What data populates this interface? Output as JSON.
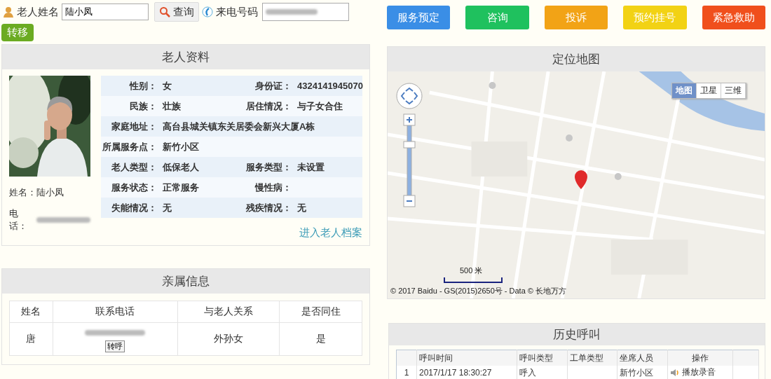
{
  "search": {
    "name_label": "老人姓名",
    "name_value": "陆小凤",
    "query_button": "查询",
    "phone_label": "来电号码"
  },
  "transfer_button": "转移",
  "action_buttons": [
    {
      "label": "服务预定",
      "color": "#3a8ee6"
    },
    {
      "label": "咨询",
      "color": "#1fc15e"
    },
    {
      "label": "投诉",
      "color": "#f2a316"
    },
    {
      "label": "预约挂号",
      "color": "#f2d214"
    },
    {
      "label": "紧急救助",
      "color": "#f04f1c"
    }
  ],
  "profile": {
    "title": "老人资料",
    "name_line": "姓名：陆小凤",
    "phone_label": "电话：",
    "fields": [
      [
        {
          "label": "性别：",
          "value": "女"
        },
        {
          "label": "身份证：",
          "value": "4324141945070"
        }
      ],
      [
        {
          "label": "民族：",
          "value": "壮族"
        },
        {
          "label": "居住情况：",
          "value": "与子女合住"
        }
      ],
      [
        {
          "label": "家庭地址：",
          "value": "高台县城关镇东关居委会新兴大厦A栋"
        }
      ],
      [
        {
          "label": "所属服务点：",
          "value": "新竹小区"
        }
      ],
      [
        {
          "label": "老人类型：",
          "value": "低保老人"
        },
        {
          "label": "服务类型：",
          "value": "未设置"
        }
      ],
      [
        {
          "label": "服务状态：",
          "value": "正常服务"
        },
        {
          "label": "慢性病："
        }
      ],
      [
        {
          "label": "失能情况：",
          "value": "无"
        },
        {
          "label": "残疾情况：",
          "value": "无"
        }
      ]
    ],
    "archive_link": "进入老人档案"
  },
  "relatives": {
    "title": "亲属信息",
    "columns": [
      "姓名",
      "联系电话",
      "与老人关系",
      "是否同住"
    ],
    "rows": [
      {
        "name": "唐",
        "call_button": "转呼",
        "relation": "外孙女",
        "lives_together": "是"
      }
    ]
  },
  "map": {
    "title": "定位地图",
    "map_types": [
      {
        "label": "地图",
        "selected": true
      },
      {
        "label": "卫星",
        "selected": false
      },
      {
        "label": "三维",
        "selected": false
      }
    ],
    "scale": "500 米",
    "copyright": "© 2017 Baidu - GS(2015)2650号 - Data © 长地万方"
  },
  "history": {
    "title": "历史呼叫",
    "columns": [
      "呼叫时间",
      "呼叫类型",
      "工单类型",
      "坐席人员",
      "操作"
    ],
    "rows": [
      {
        "index": "1",
        "time": "2017/1/17 18:30:27",
        "call_type": "呼入",
        "agent": "新竹小区",
        "action": "播放录音"
      }
    ]
  }
}
